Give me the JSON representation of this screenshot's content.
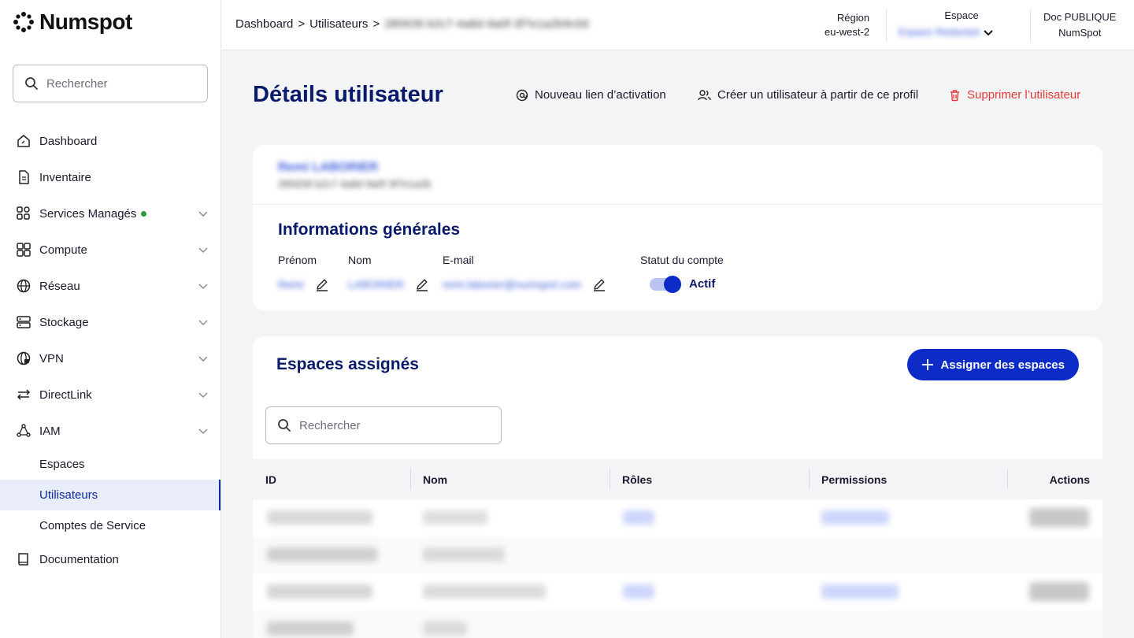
{
  "app": {
    "logo_text": "Numspot"
  },
  "sidebar": {
    "search_placeholder": "Rechercher",
    "items": [
      {
        "label": "Dashboard",
        "icon": "dashboard-icon"
      },
      {
        "label": "Inventaire",
        "icon": "inventory-icon"
      },
      {
        "label": "Services Managés",
        "icon": "managed-services-icon",
        "badge": "green-dot"
      },
      {
        "label": "Compute",
        "icon": "compute-icon"
      },
      {
        "label": "Réseau",
        "icon": "globe-icon"
      },
      {
        "label": "Stockage",
        "icon": "storage-icon"
      },
      {
        "label": "VPN",
        "icon": "vpn-icon"
      },
      {
        "label": "DirectLink",
        "icon": "directlink-icon"
      },
      {
        "label": "IAM",
        "icon": "iam-icon"
      }
    ],
    "iam_sub": [
      "Espaces",
      "Utilisateurs",
      "Comptes de Service"
    ],
    "active_sub": "Utilisateurs",
    "documentation": "Documentation"
  },
  "header": {
    "breadcrumb": [
      "Dashboard",
      ">",
      "Utilisateurs",
      ">"
    ],
    "breadcrumb_redacted": "285639 b2c7-4a8d-9a0f-3f7e1a2b9c0d",
    "region_label": "Région",
    "region_value": "eu-west-2",
    "espace_label": "Espace",
    "espace_value": "Espace Redacted",
    "doc_label": "Doc PUBLIQUE",
    "doc_value": "NumSpot"
  },
  "page": {
    "title": "Détails utilisateur",
    "action_activation": "Nouveau lien d’activation",
    "action_create": "Créer un utilisateur à partir de ce profil",
    "action_delete": "Supprimer l’utilisateur",
    "user_name_redacted": "Remi LABORIER",
    "user_id_redacted": "285639 b2c7 4a8d 9a0f 3f7e1a2b",
    "general_title": "Informations générales",
    "fields": {
      "prenom_label": "Prénom",
      "prenom_value": "Remi",
      "nom_label": "Nom",
      "nom_value": "LABORIER",
      "email_label": "E-mail",
      "email_value": "remi.laborier@numspot.com",
      "status_label": "Statut du compte",
      "status_value": "Actif"
    },
    "spaces_title": "Espaces assignés",
    "assign_button": "Assigner des espaces",
    "table_search_placeholder": "Rechercher",
    "columns": [
      "ID",
      "Nom",
      "Rôles",
      "Permissions",
      "Actions"
    ]
  },
  "colors": {
    "primary": "#0d2bc7",
    "title": "#0a1a6b",
    "danger": "#e53935",
    "status_dot": "#2a9d3a"
  }
}
